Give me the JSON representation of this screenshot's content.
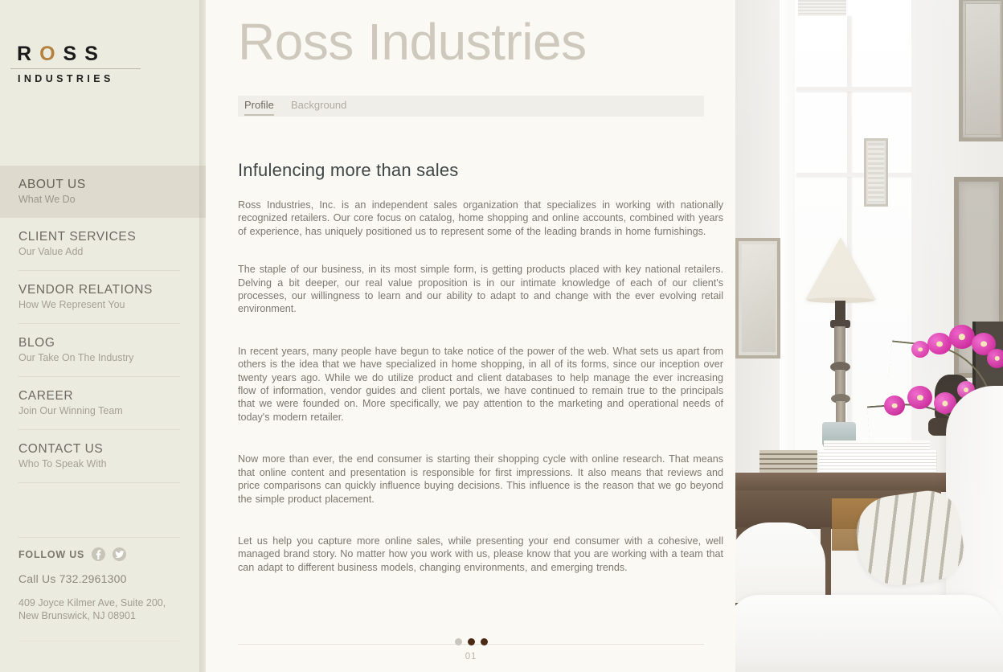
{
  "brand": {
    "logo_top_part1": "R",
    "logo_top_accent": "O",
    "logo_top_part2": "SS",
    "logo_bottom": "INDUSTRIES",
    "accent_color": "#b5813f"
  },
  "sidebar": {
    "nav": [
      {
        "title": "ABOUT US",
        "sub": "What We Do",
        "active": true
      },
      {
        "title": "CLIENT SERVICES",
        "sub": "Our Value Add",
        "active": false
      },
      {
        "title": "VENDOR RELATIONS",
        "sub": "How We Represent You",
        "active": false
      },
      {
        "title": "BLOG",
        "sub": "Our Take On The Industry",
        "active": false
      },
      {
        "title": "CAREER",
        "sub": "Join Our Winning Team",
        "active": false
      },
      {
        "title": "CONTACT US",
        "sub": "Who To Speak With",
        "active": false
      }
    ],
    "footer": {
      "follow_label": "FOLLOW US",
      "social": [
        {
          "name": "facebook-icon",
          "glyph": "f"
        },
        {
          "name": "twitter-icon",
          "glyph": "bird"
        }
      ],
      "phone": "Call Us 732.2961300",
      "address_line1": "409 Joyce Kilmer Ave, Suite 200,",
      "address_line2": "New Brunswick, NJ 08901"
    }
  },
  "main": {
    "title": "Ross Industries",
    "tabs": [
      {
        "label": "Profile",
        "active": true
      },
      {
        "label": "Background",
        "active": false
      }
    ],
    "heading": "Infulencing more than sales",
    "paragraphs": [
      "Ross Industries, Inc. is an independent sales organization that specializes in working with nationally recognized retailers. Our core focus on catalog, home shopping and online accounts, combined with years of experience, has uniquely positioned us to represent some of the leading brands in home furnishings.",
      "The staple of our business, in its most simple form, is getting products placed with key national retailers. Delving a bit deeper, our real value proposition is in our intimate knowledge of each of our client's processes, our willingness to learn and our ability to adapt to and change with the ever evolving retail environment.",
      "In recent years, many people have begun to take notice of the power of the web. What sets us apart from others is the idea that we have specialized in home shopping, in all of its forms, since our inception over twenty years ago. While we do utilize product and client databases to help manage the ever increasing flow of information, vendor guides and client portals, we have continued to remain true to the principals that we were founded on. More specifically, we pay attention to the marketing and operational needs of today's modern retailer.",
      "Now more than ever, the end consumer is starting their shopping cycle with online research.   That means that online content and presentation is responsible for first impressions.   It also means that reviews and price comparisons can quickly influence buying decisions.    This influence is the reason that we go beyond the simple product placement.",
      "Let us help you capture more online sales, while presenting your end consumer with a cohesive, well managed brand story. No matter how you work with us, please know that you are working with a team that can adapt to different business models, changing environments, and emerging trends."
    ],
    "pager": {
      "number": "01",
      "dots": [
        {
          "state": "light"
        },
        {
          "state": "dark"
        },
        {
          "state": "dark"
        }
      ],
      "light_color": "#c8c6bf",
      "dark_color": "#4a2a14"
    }
  }
}
